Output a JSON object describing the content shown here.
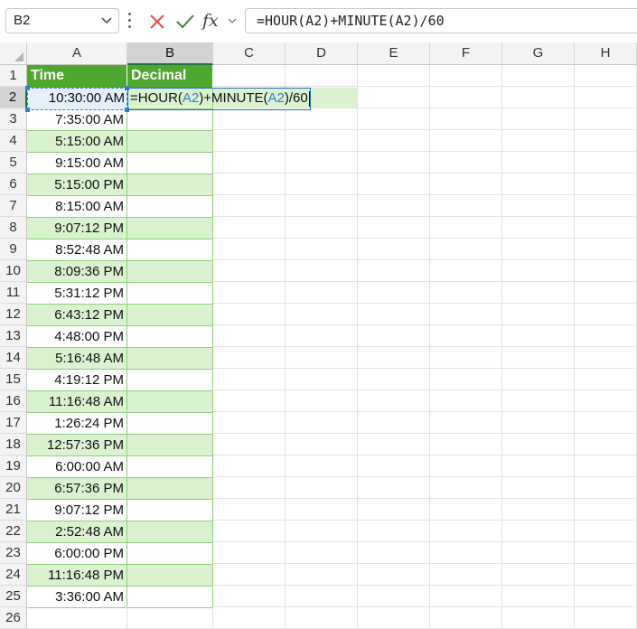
{
  "formula_bar": {
    "name_box": "B2",
    "cancel_icon": "x-icon",
    "enter_icon": "check-icon",
    "fx_label": "fx",
    "formula": "=HOUR(A2)+MINUTE(A2)/60"
  },
  "columns": [
    "A",
    "B",
    "C",
    "D",
    "E",
    "F",
    "G",
    "H"
  ],
  "selected_column": "B",
  "rows": [
    "1",
    "2",
    "3",
    "4",
    "5",
    "6",
    "7",
    "8",
    "9",
    "10",
    "11",
    "12",
    "13",
    "14",
    "15",
    "16",
    "17",
    "18",
    "19",
    "20",
    "21",
    "22",
    "23",
    "24",
    "25",
    "26"
  ],
  "selected_row": "2",
  "table": {
    "headers": {
      "a": "Time",
      "b": "Decimal"
    },
    "times": [
      "10:30:00 AM",
      "7:35:00 AM",
      "5:15:00 AM",
      "9:15:00 AM",
      "5:15:00 PM",
      "8:15:00 AM",
      "9:07:12 PM",
      "8:52:48 AM",
      "8:09:36 PM",
      "5:31:12 PM",
      "6:43:12 PM",
      "4:48:00 PM",
      "5:16:48 AM",
      "4:19:12 PM",
      "11:16:48 AM",
      "1:26:24 PM",
      "12:57:36 PM",
      "6:00:00 AM",
      "6:57:36 PM",
      "9:07:12 PM",
      "2:52:48 AM",
      "6:00:00 PM",
      "11:16:48 PM",
      "3:36:00 AM"
    ]
  },
  "editing_cell": {
    "part1": "=HOUR(",
    "ref1": "A2",
    "part2": ")+MINUTE(",
    "ref2": "A2",
    "part3": ")/60"
  },
  "colors": {
    "header_fill": "#4ea72e",
    "band_fill": "#daf2d0",
    "reference_blue": "#2f7fd1"
  }
}
